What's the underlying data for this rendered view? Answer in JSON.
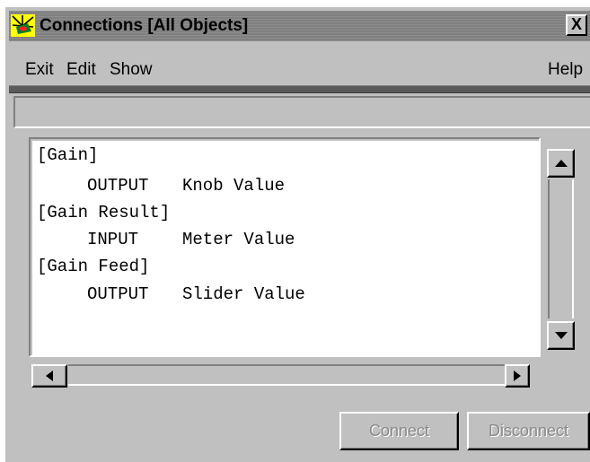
{
  "window": {
    "title": "Connections [All Objects]",
    "close_label": "X"
  },
  "menu": {
    "exit": "Exit",
    "edit": "Edit",
    "show": "Show",
    "help": "Help"
  },
  "status": {
    "text": ""
  },
  "connections": [
    {
      "object": "[Gain]",
      "direction": "OUTPUT",
      "target": "Knob Value"
    },
    {
      "object": "[Gain Result]",
      "direction": "INPUT",
      "target": "Meter Value"
    },
    {
      "object": "[Gain Feed]",
      "direction": "OUTPUT",
      "target": "Slider Value"
    }
  ],
  "buttons": {
    "connect": "Connect",
    "disconnect": "Disconnect"
  },
  "icons": {
    "app": "yellow-star-icon",
    "scroll_up": "arrow-up-icon",
    "scroll_down": "arrow-down-icon",
    "scroll_left": "arrow-left-icon",
    "scroll_right": "arrow-right-icon"
  },
  "colors": {
    "window_bg": "#c0c0c0",
    "titlebar_bg": "#808080",
    "list_bg": "#ffffff",
    "disabled_text": "#8a8a8a",
    "app_icon_bg": "#ffff00"
  }
}
